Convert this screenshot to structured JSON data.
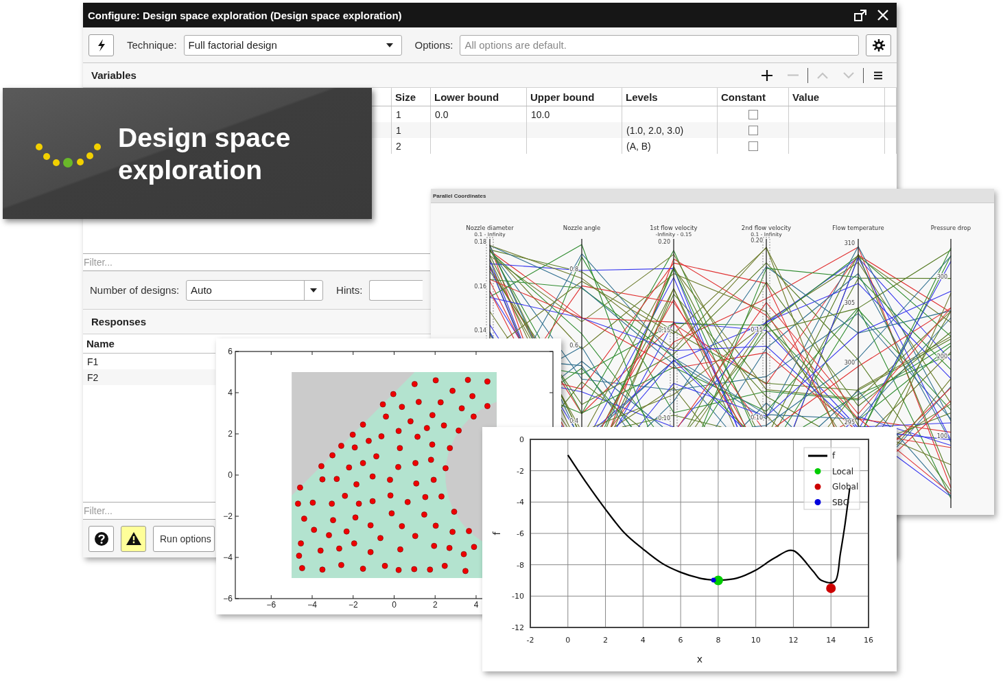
{
  "dialog": {
    "title": "Configure: Design space exploration (Design space exploration)",
    "toolbar": {
      "technique_label": "Technique:",
      "technique": "Full factorial design",
      "options_label": "Options:",
      "options_placeholder": "All options are default."
    },
    "variables": {
      "title": "Variables",
      "tools": [
        {
          "kind": "add",
          "disabled": false
        },
        {
          "kind": "remove",
          "disabled": true
        },
        {
          "kind": "up",
          "disabled": true
        },
        {
          "kind": "down",
          "disabled": true
        },
        {
          "kind": "menu",
          "disabled": false
        }
      ],
      "columns": [
        "Size",
        "Lower bound",
        "Upper bound",
        "Levels",
        "Constant",
        "Value"
      ],
      "rows": [
        {
          "size": "1",
          "lower_bound": "0.0",
          "upper_bound": "10.0",
          "constant": false
        },
        {
          "size": "1",
          "levels": "(1.0, 2.0, 3.0)",
          "constant": false
        },
        {
          "size": "2",
          "levels": "(A, B)",
          "constant": false
        }
      ],
      "filter_placeholder": "Filter..."
    },
    "designs": {
      "label": "Number of designs:",
      "value": "Auto",
      "hints_label": "Hints:"
    },
    "responses": {
      "title": "Responses",
      "columns": [
        "Name"
      ],
      "rows": [
        "F1",
        "F2"
      ],
      "filter_placeholder": "Filter..."
    },
    "buttons": [
      {
        "kind": "help"
      },
      {
        "kind": "warning"
      },
      {
        "kind": "text",
        "label": "Run options"
      }
    ]
  },
  "banner": {
    "title": "Design space exploration"
  },
  "parallel_coordinates": {
    "title": "Parallel Coordinates",
    "axes": [
      {
        "name": "Nozzle diameter",
        "range": "0.1 - Infinity",
        "ticks": [
          "0.18",
          "0.16",
          "0.14"
        ]
      },
      {
        "name": "Nozzle angle",
        "ticks": [
          "0.8",
          "0.6",
          "0.4"
        ]
      },
      {
        "name": "1st flow velocity",
        "range": "-Infinity - 0.15",
        "ticks": [
          "0.20",
          "0.15",
          "0.10"
        ]
      },
      {
        "name": "2nd flow velocity",
        "range": "0.1 - Infinity",
        "ticks": [
          "0.20",
          "0.15",
          "0.10"
        ]
      },
      {
        "name": "Flow temperature",
        "ticks": [
          "310",
          "305",
          "300",
          "295"
        ]
      },
      {
        "name": "Pressure drop",
        "ticks": [
          "300",
          "200",
          "100"
        ]
      }
    ]
  },
  "scatter_plot": {
    "chart_data": {
      "type": "scatter",
      "x": [
        1.0,
        2.03,
        3.6,
        4.55,
        -0.04,
        2.85,
        3.82,
        -0.55,
        0.38,
        1.2,
        2.27,
        3.3,
        4.55,
        -0.4,
        0.8,
        1.87,
        3.88,
        -1.52,
        1.6,
        2.43,
        3.15,
        -2.02,
        -0.62,
        0.22,
        1.14,
        -1.24,
        -2.58,
        -1.92,
        0.28,
        1.86,
        2.72,
        -3.01,
        -0.87,
        1.8,
        -3.55,
        -2.2,
        -1.52,
        0.2,
        1.04,
        2.51,
        -4.59,
        -3.5,
        -2.8,
        -1.84,
        -1.05,
        -0.2,
        1.08,
        1.93,
        -4.69,
        -3.97,
        -3.04,
        -2.4,
        -1.72,
        -1.05,
        -0.18,
        0.66,
        1.52,
        2.31,
        -4.39,
        -2.98,
        -1.89,
        -0.12,
        1.47,
        2.93,
        -3.91,
        -3.18,
        -2.32,
        -1.15,
        0.38,
        2.03,
        2.85,
        3.65,
        -0.67,
        1.03,
        -4.55,
        -3.59,
        -2.68,
        -1.95,
        -1.15,
        0.3,
        1.95,
        2.7,
        3.9,
        3.4,
        -4.64,
        -4.49,
        -3.5,
        -2.58,
        -1.52,
        -0.45,
        0.22,
        0.98,
        1.75,
        2.47,
        3.48
      ],
      "values": [
        4.42,
        4.6,
        4.62,
        4.54,
        3.93,
        4.09,
        3.83,
        3.43,
        3.31,
        3.55,
        3.53,
        3.24,
        3.35,
        2.84,
        2.61,
        2.91,
        2.84,
        2.45,
        2.28,
        2.41,
        2.16,
        1.96,
        1.88,
        2.14,
        1.86,
        1.66,
        1.42,
        1.34,
        1.31,
        1.48,
        1.31,
        0.96,
        0.91,
        0.74,
        0.43,
        0.37,
        0.58,
        0.39,
        0.58,
        0.33,
        -0.61,
        -0.21,
        -0.19,
        -0.45,
        -0.07,
        -0.23,
        -0.41,
        -0.23,
        -1.39,
        -1.34,
        -1.39,
        -1.01,
        -1.39,
        -1.27,
        -0.99,
        -1.31,
        -1.07,
        -1.04,
        -2.12,
        -2.19,
        -2.06,
        -1.86,
        -1.92,
        -1.78,
        -2.66,
        -2.92,
        -2.74,
        -2.44,
        -2.48,
        -2.46,
        -2.76,
        -2.72,
        -3.06,
        -2.96,
        -3.32,
        -3.67,
        -3.57,
        -3.32,
        -3.74,
        -3.61,
        -3.44,
        -3.54,
        -3.49,
        -3.84,
        -3.92,
        -4.52,
        -4.59,
        -4.37,
        -4.55,
        -4.41,
        -4.61,
        -4.57,
        -4.59,
        -4.41,
        -4.66
      ],
      "xlim": [
        -7.75,
        7.75
      ],
      "ylim": [
        -6,
        6
      ],
      "xticks": [
        -6,
        -4,
        -2,
        0,
        2,
        4
      ],
      "yticks": [
        -6,
        -4,
        -2,
        0,
        2,
        4,
        6
      ]
    }
  },
  "line_plot": {
    "chart_data": {
      "type": "line",
      "xlabel": "x",
      "ylabel": "f",
      "x": [
        0,
        1,
        2,
        3,
        4,
        5,
        6,
        7,
        7.75,
        8,
        9,
        10,
        11,
        12,
        13,
        13.5,
        14,
        14.25,
        14.5,
        14.75,
        15
      ],
      "grid": true,
      "legend": true,
      "series": [
        {
          "name": "f",
          "color": "#000000",
          "values": [
            -1,
            -2.8,
            -4.46,
            -5.96,
            -7.0,
            -7.9,
            -8.48,
            -8.85,
            -8.98,
            -9.0,
            -8.85,
            -8.34,
            -7.57,
            -7.1,
            -8.34,
            -9.0,
            null,
            -9.0,
            -7.3,
            -5.4,
            -3.1
          ]
        },
        {
          "name": "Local",
          "color": "#00cc00",
          "marker": "o",
          "values": [
            null,
            null,
            null,
            null,
            null,
            null,
            null,
            null,
            null,
            -9.0,
            null,
            null,
            null,
            null,
            null,
            null,
            null,
            null,
            null,
            null,
            null
          ]
        },
        {
          "name": "Global",
          "color": "#cc0000",
          "marker": "o",
          "values": [
            null,
            null,
            null,
            null,
            null,
            null,
            null,
            null,
            null,
            null,
            null,
            null,
            null,
            null,
            null,
            null,
            -9.5,
            null,
            null,
            null,
            null
          ]
        },
        {
          "name": "SBO",
          "color": "#0000dd",
          "marker": "o",
          "values": [
            null,
            null,
            null,
            null,
            null,
            null,
            null,
            null,
            -8.98,
            null,
            null,
            null,
            null,
            null,
            null,
            null,
            null,
            null,
            null,
            null,
            null
          ]
        }
      ],
      "xlim": [
        -2,
        16
      ],
      "ylim": [
        -12,
        0
      ],
      "xticks": [
        -2,
        0,
        2,
        4,
        6,
        8,
        10,
        12,
        14,
        16
      ],
      "yticks": [
        0,
        -2,
        -4,
        -6,
        -8,
        -10,
        -12
      ]
    }
  }
}
